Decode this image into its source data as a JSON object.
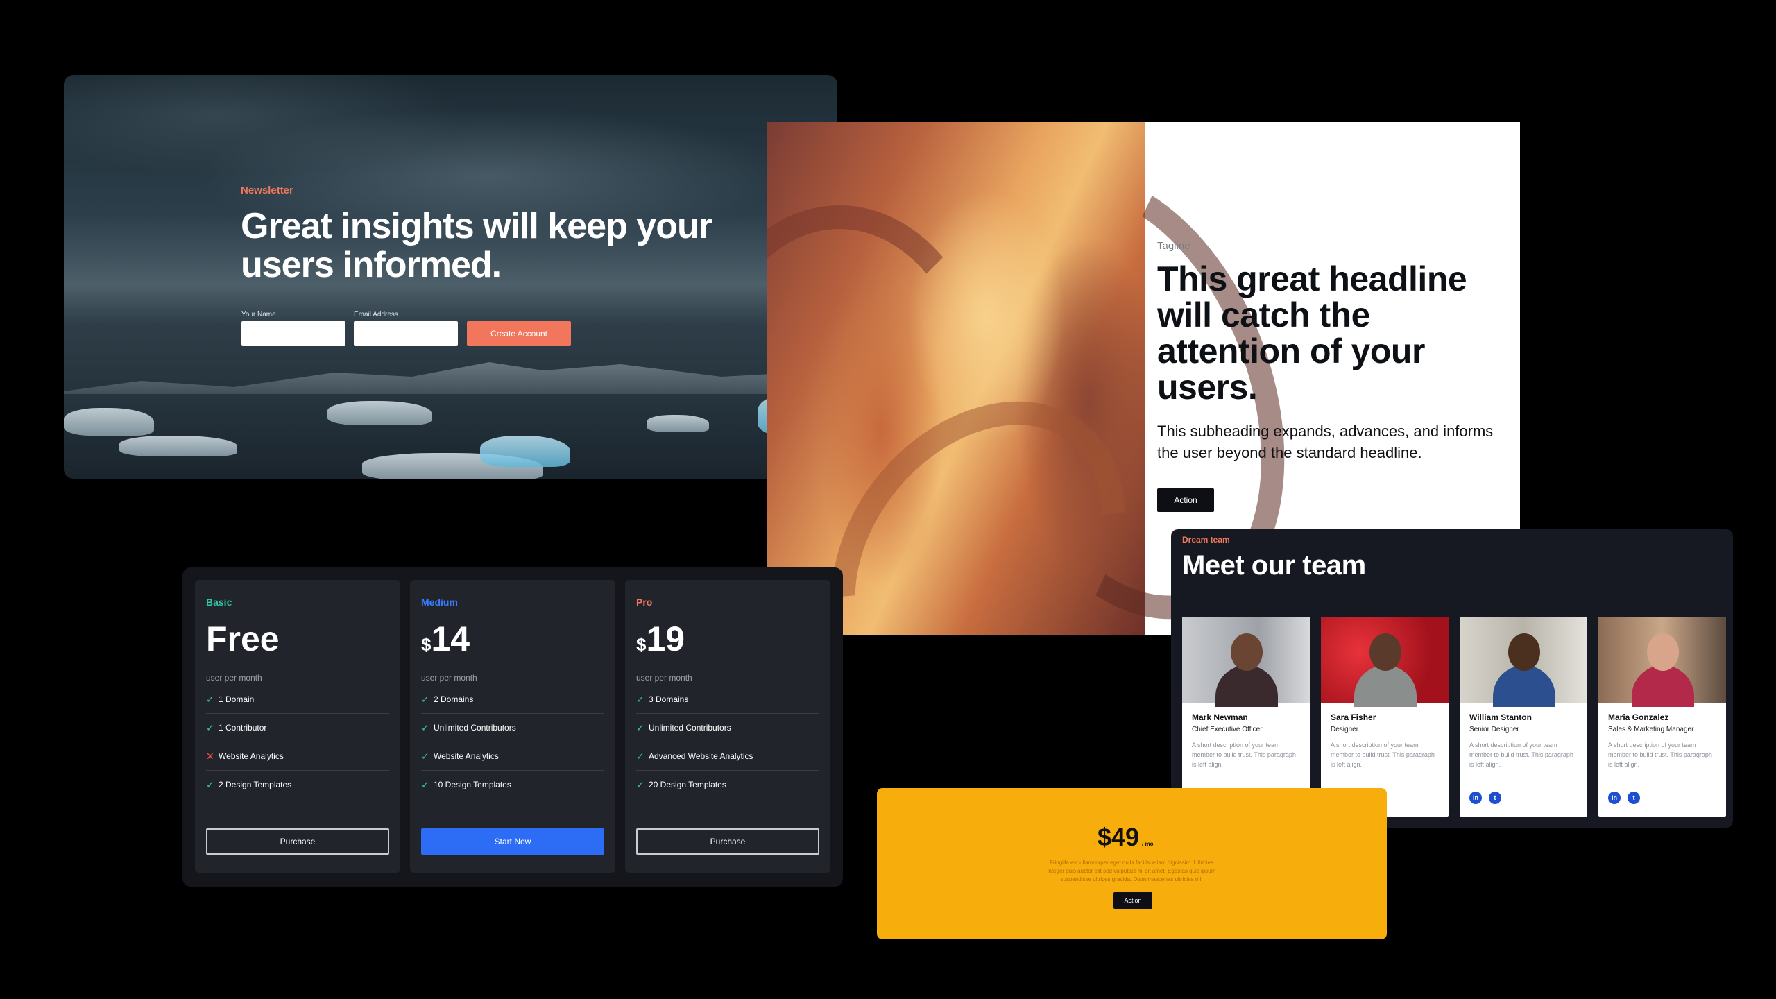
{
  "newsletter": {
    "eyebrow": "Newsletter",
    "headline": "Great insights will keep your users informed.",
    "name_label": "Your Name",
    "email_label": "Email Address",
    "button": "Create Account"
  },
  "hero": {
    "tagline": "Tagline",
    "headline": "This great headline will catch the attention of your users.",
    "subheading": "This subheading expands, advances, and informs the user beyond the standard headline.",
    "button": "Action"
  },
  "pricing": {
    "plans": [
      {
        "name": "Basic",
        "name_color": "#2ec4a5",
        "currency": "",
        "price": "Free",
        "per": "user per month",
        "features": [
          {
            "text": "1 Domain",
            "ok": true
          },
          {
            "text": "1 Contributor",
            "ok": true
          },
          {
            "text": "Website Analytics",
            "ok": false
          },
          {
            "text": "2 Design Templates",
            "ok": true
          }
        ],
        "button": "Purchase",
        "button_style": "outline"
      },
      {
        "name": "Medium",
        "name_color": "#3b7bff",
        "currency": "$",
        "price": "14",
        "per": "user per month",
        "features": [
          {
            "text": "2 Domains",
            "ok": true
          },
          {
            "text": "Unlimited Contributors",
            "ok": true
          },
          {
            "text": "Website Analytics",
            "ok": true
          },
          {
            "text": "10 Design Templates",
            "ok": true
          }
        ],
        "button": "Start Now",
        "button_style": "solid"
      },
      {
        "name": "Pro",
        "name_color": "#f2765b",
        "currency": "$",
        "price": "19",
        "per": "user per month",
        "features": [
          {
            "text": "3 Domains",
            "ok": true
          },
          {
            "text": "Unlimited Contributors",
            "ok": true
          },
          {
            "text": "Advanced Website Analytics",
            "ok": true
          },
          {
            "text": "20 Design Templates",
            "ok": true
          }
        ],
        "button": "Purchase",
        "button_style": "outline"
      }
    ]
  },
  "team": {
    "eyebrow": "Dream team",
    "title": "Meet our team",
    "members": [
      {
        "name": "Mark Newman",
        "role": "Chief Executive Officer",
        "description": "A short description of your team member to build trust. This paragraph is left align.",
        "social": false
      },
      {
        "name": "Sara Fisher",
        "role": "Designer",
        "description": "A short description of your team member to build trust. This paragraph is left align.",
        "social": false
      },
      {
        "name": "William Stanton",
        "role": "Senior Designer",
        "description": "A short description of your team member to build trust. This paragraph is left align.",
        "social": true
      },
      {
        "name": "Maria Gonzalez",
        "role": "Sales & Marketing Manager",
        "description": "A short description of your team member to build trust. This paragraph is left align.",
        "social": true
      }
    ]
  },
  "pricetag": {
    "price": "$49",
    "unit": "/ mo",
    "text": "Fringilla est ullamcorper eget nulla facilisi etiam dignissim. Ultricies integer quis auctor elit sed vulputate mi sit amet. Egestas quis ipsum suspendisse ultrices gravida. Diam maecenas ultricies mi.",
    "button": "Action"
  }
}
